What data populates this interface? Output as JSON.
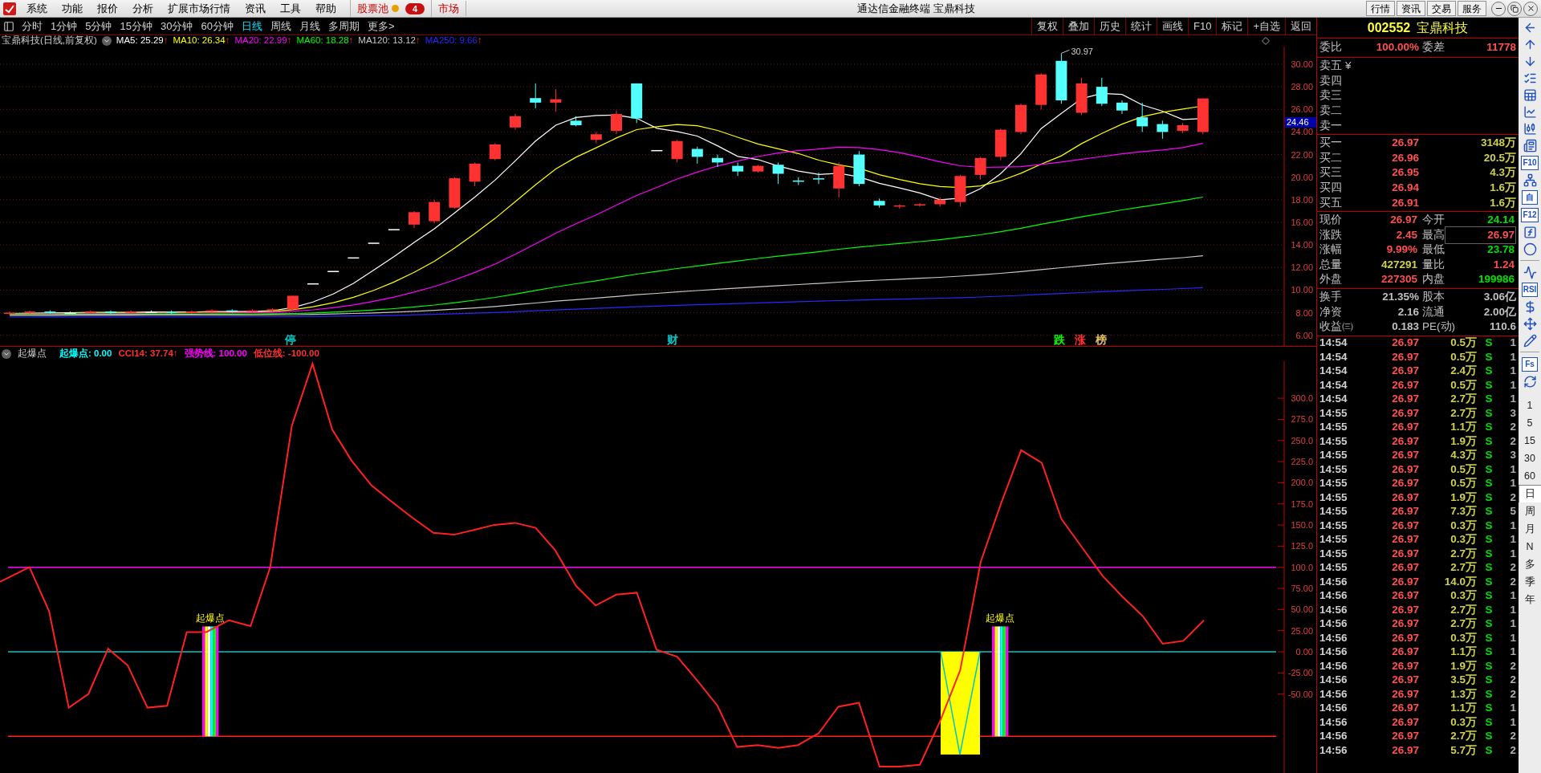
{
  "menu_bar": {
    "items": [
      "系统",
      "功能",
      "报价",
      "分析",
      "扩展市场行情",
      "资讯",
      "工具",
      "帮助"
    ],
    "stock_pool": {
      "label": "股票池",
      "badge": "4"
    },
    "market": "市场",
    "title": "通达信金融终端 宝鼎科技",
    "right_buttons": [
      "行情",
      "资讯",
      "交易",
      "服务"
    ]
  },
  "period_tabs": [
    {
      "label": "分时",
      "selected": false
    },
    {
      "label": "1分钟",
      "selected": false
    },
    {
      "label": "5分钟",
      "selected": false
    },
    {
      "label": "15分钟",
      "selected": false
    },
    {
      "label": "30分钟",
      "selected": false
    },
    {
      "label": "60分钟",
      "selected": false
    },
    {
      "label": "日线",
      "selected": true
    },
    {
      "label": "周线",
      "selected": false
    },
    {
      "label": "月线",
      "selected": false
    },
    {
      "label": "多周期",
      "selected": false
    },
    {
      "label": "更多>",
      "selected": false
    }
  ],
  "chart_tools": [
    "复权",
    "叠加",
    "历史",
    "统计",
    "画线",
    "F10",
    "标记",
    "+自选",
    "返回"
  ],
  "main_chart": {
    "title": "宝鼎科技(日线,前复权)",
    "ma_legend": [
      {
        "text": "MA5: 25.29",
        "arrow": "↑",
        "color": "#ffffff"
      },
      {
        "text": "MA10: 26.34",
        "arrow": "↑",
        "color": "#ffff00"
      },
      {
        "text": "MA20: 22.99",
        "arrow": "↑",
        "color": "#ff00ff"
      },
      {
        "text": "MA60: 18.28",
        "arrow": "↑",
        "color": "#00ff00"
      },
      {
        "text": "MA120: 13.12",
        "arrow": "↑",
        "color": "#c8c8c8"
      },
      {
        "text": "MA250: 9.66",
        "arrow": "↑",
        "color": "#2828ff"
      }
    ],
    "high_label": "30.97",
    "current_price_tag": "24.46",
    "axis_labels": [
      "30.00",
      "28.00",
      "26.00",
      "24.00",
      "22.00",
      "20.00",
      "18.00",
      "16.00",
      "14.00",
      "12.00",
      "10.00",
      "8.00",
      "6.00"
    ],
    "event_marks": [
      {
        "text": "停",
        "color": "#00c8c8"
      },
      {
        "text": "财",
        "color": "#00c8c8"
      },
      {
        "text": "跌",
        "color": "#00ff00"
      },
      {
        "text": "涨",
        "color": "#ff3030"
      },
      {
        "text": "榜",
        "color": "#e0c060"
      }
    ]
  },
  "indicator": {
    "name": "起爆点",
    "values": [
      {
        "text": "起爆点: 0.00",
        "color": "#00ffff"
      },
      {
        "text": "CCI14: 37.74",
        "arrow": "↑",
        "color": "#ff3030"
      },
      {
        "text": "强势线: 100.00",
        "color": "#ff00ff"
      },
      {
        "text": "低位线: -100.00",
        "color": "#ff3030"
      }
    ],
    "signals": [
      "起爆点",
      "起爆点"
    ],
    "axis_labels": [
      "300.0",
      "275.0",
      "250.0",
      "225.0",
      "200.0",
      "175.0",
      "150.0",
      "125.0",
      "100.0",
      "75.00",
      "50.00",
      "25.00",
      "0.00",
      "-25.00",
      "-50.00"
    ]
  },
  "quote_panel": {
    "code": "002552",
    "name": "宝鼎科技",
    "order_ratio": {
      "label": "委比",
      "value": "100.00%",
      "diff_label": "委差",
      "diff_value": "11778"
    },
    "sell_levels": [
      "卖五",
      "卖四",
      "卖三",
      "卖二",
      "卖一"
    ],
    "price_unit_mark": "¥",
    "buy_levels": [
      {
        "label": "买一",
        "price": "26.97",
        "volume": "3148万"
      },
      {
        "label": "买二",
        "price": "26.96",
        "volume": "20.5万"
      },
      {
        "label": "买三",
        "price": "26.95",
        "volume": "4.3万"
      },
      {
        "label": "买四",
        "price": "26.94",
        "volume": "1.6万"
      },
      {
        "label": "买五",
        "price": "26.91",
        "volume": "1.6万"
      }
    ],
    "stats": [
      [
        {
          "label": "现价",
          "value": "26.97",
          "color": "#ff5050",
          "outlined": false
        },
        {
          "label": "今开",
          "value": "24.14",
          "color": "#00e000",
          "outlined": false
        }
      ],
      [
        {
          "label": "涨跌",
          "value": "2.45",
          "color": "#ff5050",
          "outlined": false
        },
        {
          "label": "最高",
          "value": "26.97",
          "color": "#ff5050",
          "outlined": true
        }
      ],
      [
        {
          "label": "涨幅",
          "value": "9.99%",
          "color": "#ff5050",
          "outlined": false
        },
        {
          "label": "最低",
          "value": "23.78",
          "color": "#00e000",
          "outlined": false
        }
      ],
      [
        {
          "label": "总量",
          "value": "427291",
          "color": "#d0d050",
          "outlined": false
        },
        {
          "label": "量比",
          "value": "1.24",
          "color": "#ff5050",
          "outlined": false
        }
      ],
      [
        {
          "label": "外盘",
          "value": "227305",
          "color": "#ff5050",
          "outlined": false
        },
        {
          "label": "内盘",
          "value": "199986",
          "color": "#00e000",
          "outlined": false
        }
      ]
    ],
    "fundamentals": [
      [
        {
          "label": "换手",
          "value": "21.35%"
        },
        {
          "label": "股本",
          "value": "3.06亿"
        }
      ],
      [
        {
          "label": "净资",
          "value": "2.16"
        },
        {
          "label": "流通",
          "value": "2.00亿"
        }
      ],
      [
        {
          "label": "收益㈢",
          "value": "0.183"
        },
        {
          "label": "PE(动)",
          "value": "110.6"
        }
      ]
    ],
    "ticks": [
      {
        "time": "14:54",
        "price": "26.97",
        "volume": "0.5万",
        "side": "S",
        "count": "1"
      },
      {
        "time": "14:54",
        "price": "26.97",
        "volume": "0.5万",
        "side": "S",
        "count": "1"
      },
      {
        "time": "14:54",
        "price": "26.97",
        "volume": "2.4万",
        "side": "S",
        "count": "1"
      },
      {
        "time": "14:54",
        "price": "26.97",
        "volume": "0.5万",
        "side": "S",
        "count": "1"
      },
      {
        "time": "14:54",
        "price": "26.97",
        "volume": "2.7万",
        "side": "S",
        "count": "1"
      },
      {
        "time": "14:55",
        "price": "26.97",
        "volume": "2.7万",
        "side": "S",
        "count": "3"
      },
      {
        "time": "14:55",
        "price": "26.97",
        "volume": "1.1万",
        "side": "S",
        "count": "2"
      },
      {
        "time": "14:55",
        "price": "26.97",
        "volume": "1.9万",
        "side": "S",
        "count": "2"
      },
      {
        "time": "14:55",
        "price": "26.97",
        "volume": "4.3万",
        "side": "S",
        "count": "3"
      },
      {
        "time": "14:55",
        "price": "26.97",
        "volume": "0.5万",
        "side": "S",
        "count": "1"
      },
      {
        "time": "14:55",
        "price": "26.97",
        "volume": "0.5万",
        "side": "S",
        "count": "1"
      },
      {
        "time": "14:55",
        "price": "26.97",
        "volume": "1.9万",
        "side": "S",
        "count": "2"
      },
      {
        "time": "14:55",
        "price": "26.97",
        "volume": "7.3万",
        "side": "S",
        "count": "5"
      },
      {
        "time": "14:55",
        "price": "26.97",
        "volume": "0.3万",
        "side": "S",
        "count": "1"
      },
      {
        "time": "14:55",
        "price": "26.97",
        "volume": "0.3万",
        "side": "S",
        "count": "1"
      },
      {
        "time": "14:55",
        "price": "26.97",
        "volume": "2.7万",
        "side": "S",
        "count": "1"
      },
      {
        "time": "14:55",
        "price": "26.97",
        "volume": "2.7万",
        "side": "S",
        "count": "2"
      },
      {
        "time": "14:56",
        "price": "26.97",
        "volume": "14.0万",
        "side": "S",
        "count": "2"
      },
      {
        "time": "14:56",
        "price": "26.97",
        "volume": "0.3万",
        "side": "S",
        "count": "1"
      },
      {
        "time": "14:56",
        "price": "26.97",
        "volume": "2.7万",
        "side": "S",
        "count": "1"
      },
      {
        "time": "14:56",
        "price": "26.97",
        "volume": "2.7万",
        "side": "S",
        "count": "1"
      },
      {
        "time": "14:56",
        "price": "26.97",
        "volume": "0.3万",
        "side": "S",
        "count": "1"
      },
      {
        "time": "14:56",
        "price": "26.97",
        "volume": "1.1万",
        "side": "S",
        "count": "1"
      },
      {
        "time": "14:56",
        "price": "26.97",
        "volume": "1.9万",
        "side": "S",
        "count": "2"
      },
      {
        "time": "14:56",
        "price": "26.97",
        "volume": "3.5万",
        "side": "S",
        "count": "2"
      },
      {
        "time": "14:56",
        "price": "26.97",
        "volume": "1.3万",
        "side": "S",
        "count": "2"
      },
      {
        "time": "14:56",
        "price": "26.97",
        "volume": "1.1万",
        "side": "S",
        "count": "1"
      },
      {
        "time": "14:56",
        "price": "26.97",
        "volume": "0.3万",
        "side": "S",
        "count": "1"
      },
      {
        "time": "14:56",
        "price": "26.97",
        "volume": "2.7万",
        "side": "S",
        "count": "2"
      },
      {
        "time": "14:56",
        "price": "26.97",
        "volume": "5.7万",
        "side": "S",
        "count": "2"
      }
    ]
  },
  "side_toolbar": {
    "text_tools": [
      "F10",
      "自",
      "F12",
      "RSI",
      "Fs"
    ],
    "periods": [
      {
        "label": "1",
        "selected": false
      },
      {
        "label": "5",
        "selected": false
      },
      {
        "label": "15",
        "selected": false
      },
      {
        "label": "30",
        "selected": false
      },
      {
        "label": "60",
        "selected": false
      },
      {
        "label": "日",
        "selected": true
      },
      {
        "label": "周",
        "selected": false
      },
      {
        "label": "月",
        "selected": false
      },
      {
        "label": "N",
        "selected": false
      },
      {
        "label": "多",
        "selected": false
      },
      {
        "label": "季",
        "selected": false
      },
      {
        "label": "年",
        "selected": false
      }
    ]
  }
}
